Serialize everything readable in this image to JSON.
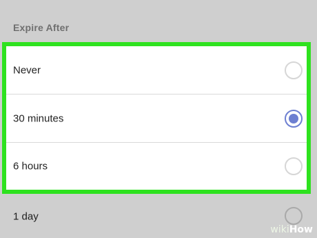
{
  "section": {
    "title": "Expire After"
  },
  "options": [
    {
      "label": "Never",
      "selected": false
    },
    {
      "label": "30 minutes",
      "selected": true
    },
    {
      "label": "6 hours",
      "selected": false
    },
    {
      "label": "1 day",
      "selected": false
    }
  ],
  "colors": {
    "highlight": "#2ee21f",
    "radio_selected": "#6d7fd1",
    "background": "#cfcfcf"
  },
  "watermark": {
    "prefix": "wiki",
    "suffix": "How"
  }
}
